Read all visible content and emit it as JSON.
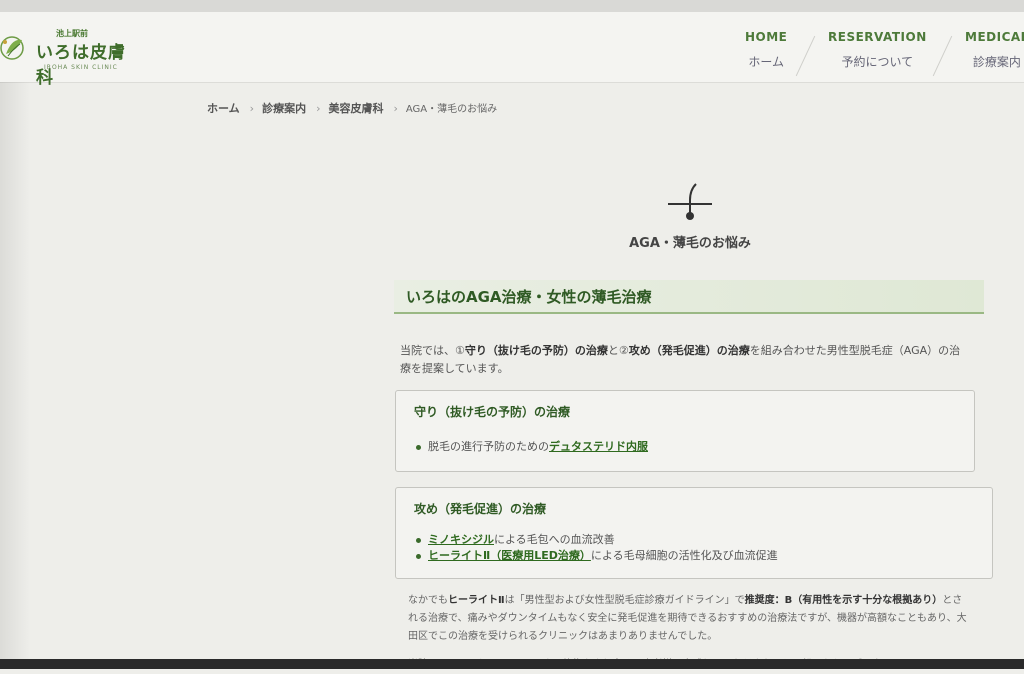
{
  "header": {
    "logo_sub": "池上駅前",
    "logo_name": "いろは皮膚科",
    "logo_en": "IROHA SKIN CLINIC"
  },
  "nav": [
    {
      "en": "HOME",
      "jp": "ホーム"
    },
    {
      "en": "RESERVATION",
      "jp": "予約について"
    },
    {
      "en": "MEDICAL",
      "jp": "診療案内"
    }
  ],
  "breadcrumb": {
    "items": [
      "ホーム",
      "診療案内",
      "美容皮膚科"
    ],
    "separator": "›",
    "current": "AGA・薄毛のお悩み"
  },
  "page": {
    "title": "AGA・薄毛のお悩み",
    "icon": "hair-follicle-icon"
  },
  "section": {
    "heading": "いろはのAGA治療・女性の薄毛治療",
    "intro_1": "当院では、①",
    "intro_b1": "守り（抜け毛の予防）の治療",
    "intro_2": "と②",
    "intro_b2": "攻め（発毛促進）の治療",
    "intro_3": "を組み合わせた男性型脱毛症（AGA）の治療を提案しています。"
  },
  "box_defense": {
    "title": "守り（抜け毛の予防）の治療",
    "item_pre": "脱毛の進行予防のための",
    "item_link": "デュタステリド内服"
  },
  "box_offense": {
    "title": "攻め（発毛促進）の治療",
    "item1_link": "ミノキシジル",
    "item1_post": "による毛包への血流改善",
    "item2_link": "ヒーライトⅡ（医療用LED治療）",
    "item2_post": "による毛母細胞の活性化及び血流促進"
  },
  "footnote": {
    "p1_pre": "なかでも",
    "p1_b1": "ヒーライトⅡ",
    "p1_mid": "は「男性型および女性型脱毛症診療ガイドライン」で",
    "p1_b2": "推奨度：B（有用性を示す十分な根拠あり）",
    "p1_post": "とされる治療で、痛みやダウンタイムもなく安全に発毛促進を期待できるおすすめの治療法ですが、機器が高額なこともあり、大田区でこの治療を受けられるクリニックはあまりありませんでした。",
    "p2": "当院では、このヒーライトⅡによる施術をより多くの患者様に実感していただきたいとの想いから、デュタ"
  },
  "colors": {
    "accent_green": "#2f5a24",
    "link_green": "#2f6a1f",
    "heading_bg": "#e4ebdc"
  }
}
